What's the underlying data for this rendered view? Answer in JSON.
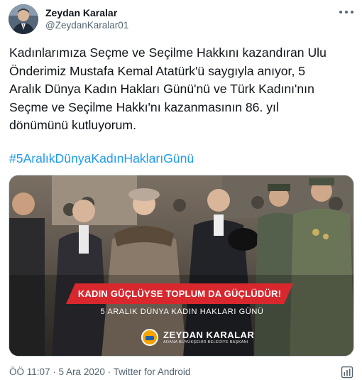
{
  "author": {
    "display_name": "Zeydan Karalar",
    "handle": "@ZeydanKaralar01"
  },
  "tweet": {
    "text": "Kadınlarımıza Seçme ve Seçilme Hakkını kazandıran Ulu\nÖnderimiz Mustafa Kemal Atatürk'ü saygıyla anıyor, 5\nAralık Dünya Kadın Hakları Günü'nü ve Türk Kadını'nın\nSeçme ve Seçilme Hakkı'nı kazanmasının 86. yıl\ndönümünü kutluyorum.",
    "hashtag": "#5AralıkDünyaKadınHaklarıGünü"
  },
  "media": {
    "banner_text": "KADIN GÜÇLÜYSE TOPLUM DA GÜÇLÜDÜR!",
    "sub_banner_text": "5 ARALIK DÜNYA KADIN HAKLARI GÜNÜ",
    "brand_name": "ZEYDAN KARALAR",
    "brand_subtitle": "ADANA BÜYÜKŞEHİR BELEDİYE BAŞKANI"
  },
  "footer": {
    "time": "ÖÖ 11:07",
    "separator1": " · ",
    "date": "5 Ara 2020",
    "separator2": " · ",
    "source": "Twitter for Android"
  },
  "colors": {
    "link": "#1d9bf0",
    "secondary_text": "#536471",
    "banner_red": "#d9272e"
  },
  "icons": {
    "more": "more-dots-icon",
    "analytics": "analytics-icon"
  }
}
